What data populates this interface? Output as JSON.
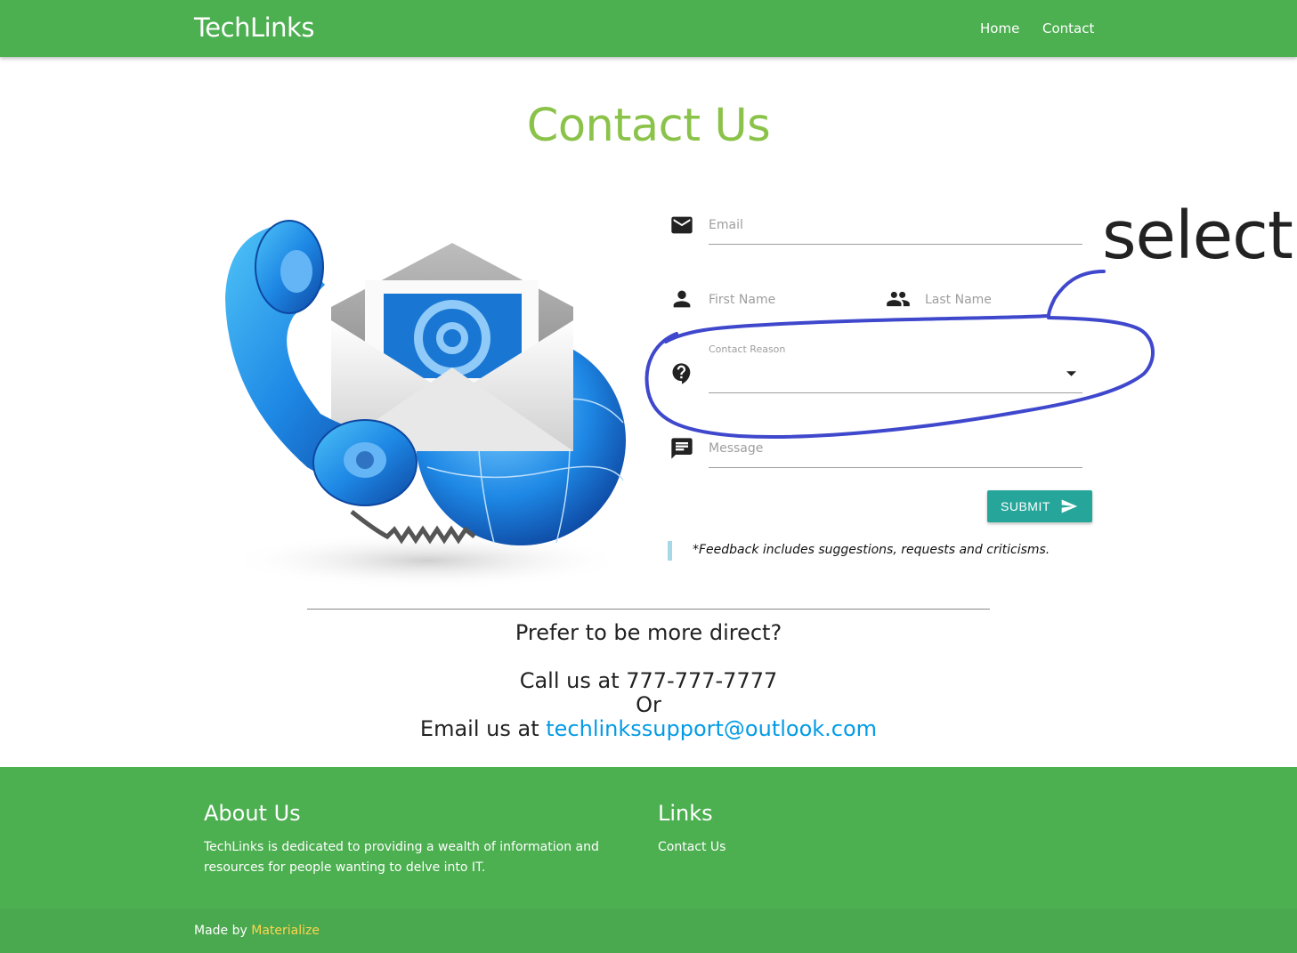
{
  "nav": {
    "brand": "TechLinks",
    "links": [
      {
        "label": "Home"
      },
      {
        "label": "Contact"
      }
    ],
    "color": "#4caf50"
  },
  "page": {
    "title": "Contact Us",
    "title_color": "#8bc34a"
  },
  "form": {
    "email_placeholder": "Email",
    "first_name_placeholder": "First Name",
    "last_name_placeholder": "Last Name",
    "contact_reason_label": "Contact Reason",
    "contact_reason_value": "",
    "message_placeholder": "Message",
    "submit_label": "SUBMIT",
    "submit_color": "#26a69a",
    "feedback_note": "*Feedback includes suggestions, requests and criticisms."
  },
  "direct": {
    "heading": "Prefer to be more direct?",
    "call": "Call us at 777-777-7777",
    "or": "Or",
    "email_prefix": "Email us at",
    "email": "techlinkssupport@outlook.com"
  },
  "annotation": {
    "text": "select",
    "color": "#3f48cc"
  },
  "footer": {
    "about_title": "About Us",
    "about_text": "TechLinks is dedicated to providing a wealth of information and resources for people wanting to delve into IT.",
    "links_title": "Links",
    "links": [
      {
        "label": "Contact Us"
      }
    ],
    "made_by_prefix": "Made by",
    "made_by_link": "Materialize"
  },
  "icons": [
    "email-icon",
    "person-icon",
    "people-icon",
    "help-icon",
    "message-icon",
    "send-icon",
    "dropdown-arrow-icon"
  ]
}
